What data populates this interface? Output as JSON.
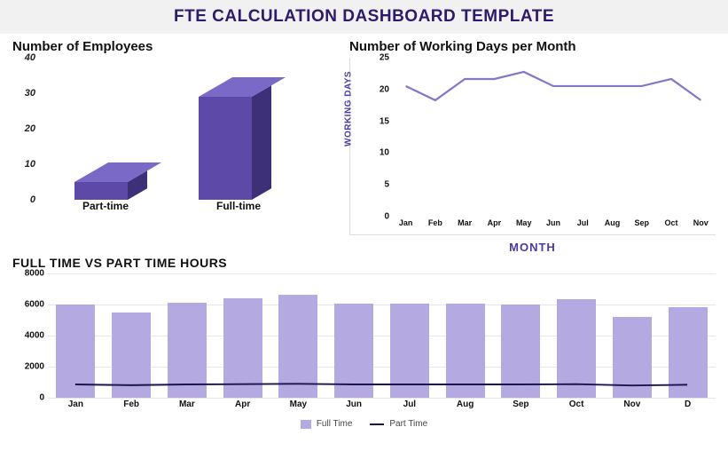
{
  "header": {
    "title": "FTE CALCULATION DASHBOARD TEMPLATE"
  },
  "employees_chart": {
    "title": "Number of Employees",
    "y_ticks": [
      0,
      10,
      20,
      30,
      40
    ],
    "categories": [
      "Part-time",
      "Full-time"
    ]
  },
  "working_days_chart": {
    "title": "Number of Working Days per Month",
    "y_label": "WORKING DAYS",
    "x_label": "MONTH",
    "y_ticks": [
      0,
      5,
      10,
      15,
      20,
      25
    ],
    "categories": [
      "Jan",
      "Feb",
      "Mar",
      "Apr",
      "May",
      "Jun",
      "Jul",
      "Aug",
      "Sep",
      "Oct",
      "Nov"
    ]
  },
  "hours_chart": {
    "title": "FULL TIME VS PART TIME HOURS",
    "y_ticks": [
      0,
      2000,
      4000,
      6000,
      8000
    ],
    "categories": [
      "Jan",
      "Feb",
      "Mar",
      "Apr",
      "May",
      "Jun",
      "Jul",
      "Aug",
      "Sep",
      "Oct",
      "Nov",
      "D"
    ],
    "legend": {
      "full": "Full Time",
      "part": "Part Time"
    }
  },
  "chart_data": [
    {
      "id": "number_of_employees",
      "type": "bar",
      "title": "Number of Employees",
      "categories": [
        "Part-time",
        "Full-time"
      ],
      "values": [
        5,
        29
      ],
      "ylim": [
        0,
        40
      ]
    },
    {
      "id": "working_days_per_month",
      "type": "line",
      "title": "Number of Working Days per Month",
      "xlabel": "MONTH",
      "ylabel": "WORKING DAYS",
      "categories": [
        "Jan",
        "Feb",
        "Mar",
        "Apr",
        "May",
        "Jun",
        "Jul",
        "Aug",
        "Sep",
        "Oct",
        "Nov"
      ],
      "values": [
        21,
        19,
        22,
        22,
        23,
        21,
        21,
        21,
        21,
        22,
        19
      ],
      "ylim": [
        0,
        25
      ]
    },
    {
      "id": "full_vs_part_time_hours",
      "type": "bar",
      "title": "FULL TIME VS PART TIME HOURS",
      "categories": [
        "Jan",
        "Feb",
        "Mar",
        "Apr",
        "May",
        "Jun",
        "Jul",
        "Aug",
        "Sep",
        "Oct",
        "Nov",
        "Dec"
      ],
      "series": [
        {
          "name": "Full Time",
          "values": [
            6000,
            5500,
            6100,
            6400,
            6650,
            6050,
            6050,
            6050,
            6000,
            6350,
            5200,
            5850
          ]
        },
        {
          "name": "Part Time",
          "values": [
            600,
            550,
            600,
            620,
            640,
            600,
            600,
            600,
            600,
            620,
            530,
            580
          ]
        }
      ],
      "ylim": [
        0,
        8000
      ]
    }
  ]
}
